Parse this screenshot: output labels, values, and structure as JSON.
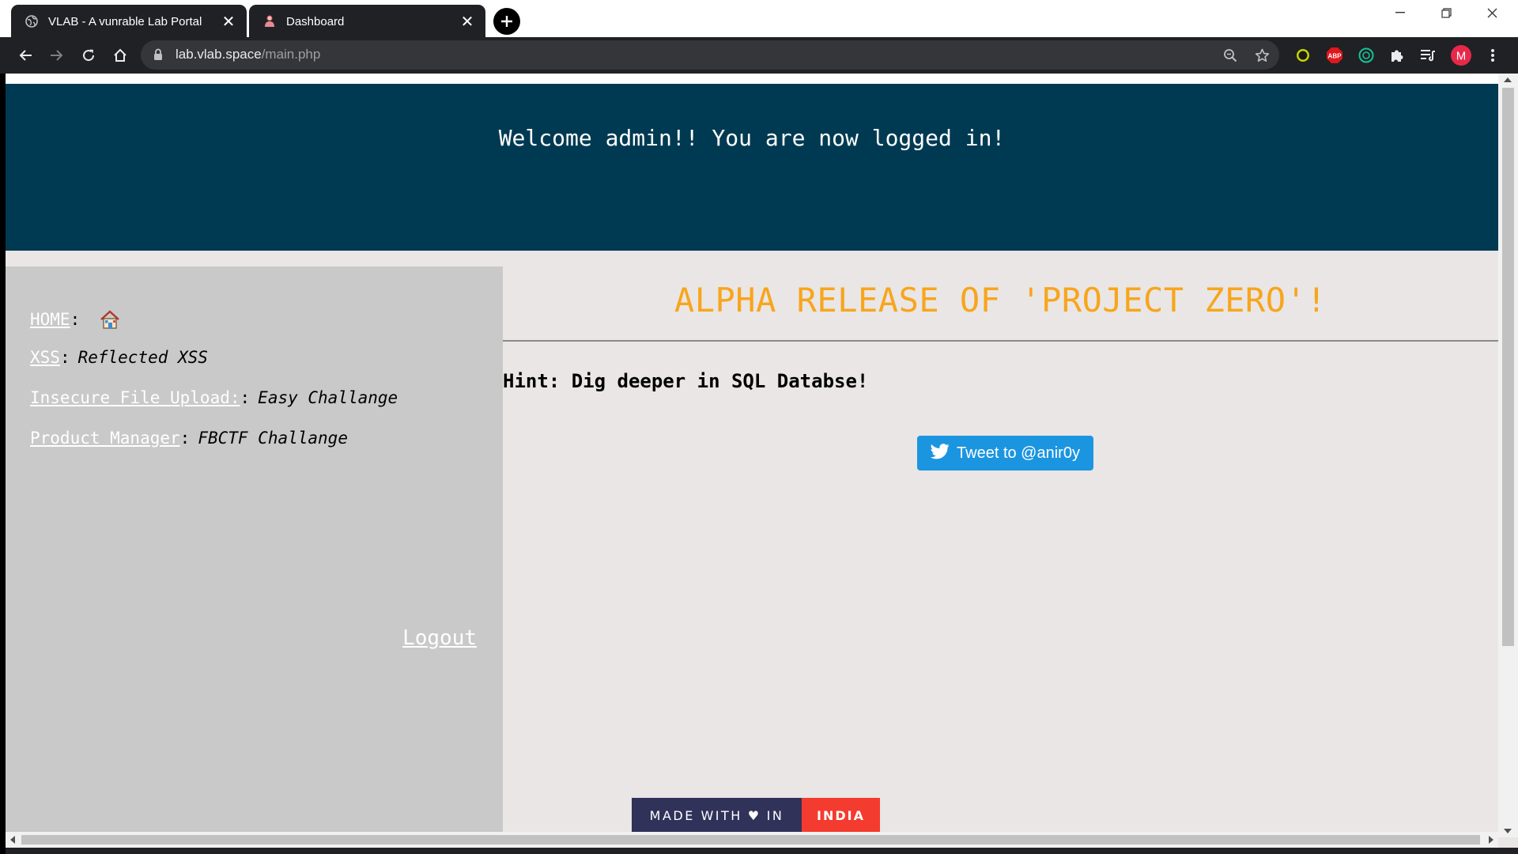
{
  "browser": {
    "tabs": [
      {
        "title": "VLAB - A vunrable Lab Portal",
        "favicon": "globe-icon",
        "active": true
      },
      {
        "title": "Dashboard",
        "favicon": "user-icon",
        "active": false
      }
    ],
    "new_tab_icon": "plus-icon",
    "window_controls": [
      "minimize-icon",
      "restore-icon",
      "close-icon"
    ],
    "address": {
      "host": "lab.vlab.space",
      "path": "/main.php"
    },
    "extensions": [
      "zoom-icon",
      "star-icon",
      "extension-circle-icon",
      "adblock-icon",
      "grammarly-icon",
      "puzzle-icon",
      "media-queue-icon"
    ],
    "profile_initial": "M",
    "colors": {
      "chrome_dark": "#202124",
      "omnibox": "#35363a",
      "profile": "#e8284b",
      "abp": "#e0171b",
      "grammarly": "#15c39a"
    }
  },
  "page": {
    "header": {
      "welcome": "Welcome admin!! You are now logged in!"
    },
    "sidebar": {
      "items": [
        {
          "link": "HOME",
          "sep": ":",
          "desc": ""
        },
        {
          "link": "XSS",
          "sep": ":",
          "desc": "Reflected XSS"
        },
        {
          "link": "Insecure File Upload:",
          "sep": ":",
          "desc": "Easy Challange"
        },
        {
          "link": "Product Manager",
          "sep": ":",
          "desc": "FBCTF Challange"
        }
      ],
      "logout": "Logout"
    },
    "main": {
      "headline": "ALPHA RELEASE OF 'PROJECT ZERO'!",
      "hint": "Hint: Dig deeper in SQL Databse!",
      "tweet_button": "Tweet to @anir0y"
    },
    "badge": {
      "left": "MADE WITH",
      "heart": "♥",
      "in": "IN",
      "right": "INDIA"
    },
    "colors": {
      "header_bg": "#003a52",
      "sidebar_bg": "#c9c9c9",
      "main_bg": "#e9e6e5",
      "headline": "#f8a51c",
      "tweet": "#1b95e0",
      "badge_left": "#31325a",
      "badge_right": "#f43b2f"
    }
  }
}
